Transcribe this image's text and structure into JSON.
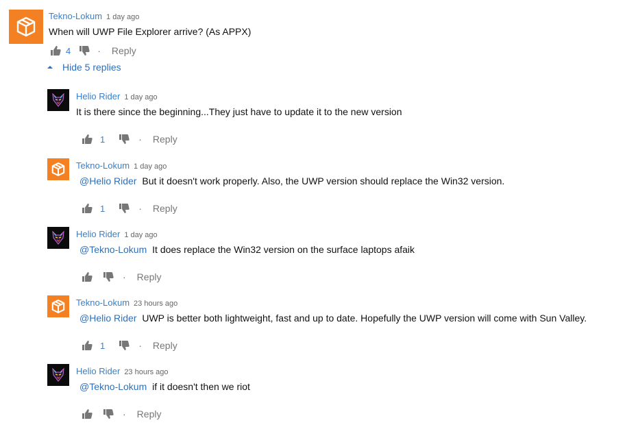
{
  "thread": {
    "author": "Tekno-Lokum",
    "time": "1 day ago",
    "text": "When will UWP File Explorer arrive? (As APPX)",
    "likes": "4",
    "reply_label": "Reply",
    "toggle_label": "Hide 5 replies"
  },
  "replies": [
    {
      "author": "Helio Rider",
      "time": "1 day ago",
      "mention": "",
      "text": "It is there since the beginning...They just have to update it to the new version",
      "likes": "1",
      "reply_label": "Reply"
    },
    {
      "author": "Tekno-Lokum",
      "time": "1 day ago",
      "mention": "@Helio Rider",
      "text": "But it doesn't work properly. Also, the UWP version should replace the Win32 version.",
      "likes": "1",
      "reply_label": "Reply"
    },
    {
      "author": "Helio Rider",
      "time": "1 day ago",
      "mention": "@Tekno-Lokum",
      "text": "It does replace the Win32 version on the surface laptops afaik",
      "likes": "",
      "reply_label": "Reply"
    },
    {
      "author": "Tekno-Lokum",
      "time": "23 hours ago",
      "mention": "@Helio Rider",
      "text": "UWP is better both lightweight, fast and up to date. Hopefully the UWP version will come with Sun Valley.",
      "likes": "1",
      "reply_label": "Reply"
    },
    {
      "author": "Helio Rider",
      "time": "23 hours ago",
      "mention": "@Tekno-Lokum",
      "text": "if it doesn't then we riot",
      "likes": "",
      "reply_label": "Reply"
    }
  ],
  "colors": {
    "accent": "#3a7fc7",
    "avatar_orange": "#f48024",
    "avatar_dark": "#0b0b0b"
  },
  "icons": {
    "like": "thumbs-up-icon",
    "dislike": "thumbs-down-icon",
    "avatar_orange": "box-icon",
    "avatar_dark": "wolf-icon",
    "toggle": "caret-up-icon"
  }
}
